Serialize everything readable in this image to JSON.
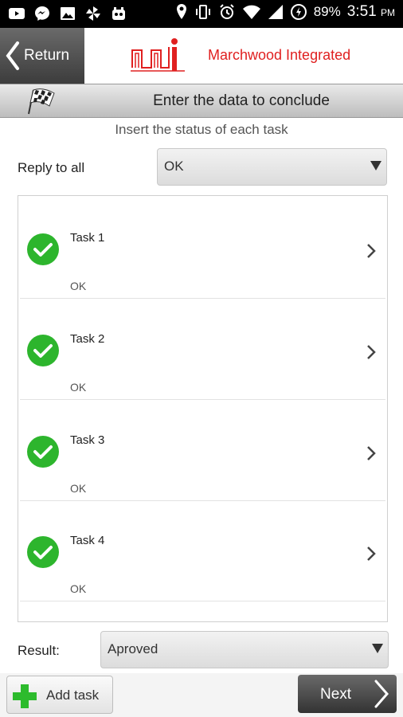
{
  "status_bar": {
    "battery": "89%",
    "time": "3:51",
    "ampm": "PM"
  },
  "header": {
    "return_label": "Return",
    "brand": "Marchwood Integrated"
  },
  "title_bar": {
    "title": "Enter the data to conclude"
  },
  "instruction": "Insert the status of each task",
  "reply_all": {
    "label": "Reply to all",
    "value": "OK"
  },
  "tasks": [
    {
      "name": "Task 1",
      "status": "OK"
    },
    {
      "name": "Task 2",
      "status": "OK"
    },
    {
      "name": "Task 3",
      "status": "OK"
    },
    {
      "name": "Task 4",
      "status": "OK"
    }
  ],
  "result": {
    "label": "Result:",
    "value": "Aproved"
  },
  "footer": {
    "add_task_label": "Add task",
    "next_label": "Next"
  },
  "colors": {
    "brand": "#e02020",
    "check": "#2db52d",
    "plus": "#2dbb2d"
  }
}
